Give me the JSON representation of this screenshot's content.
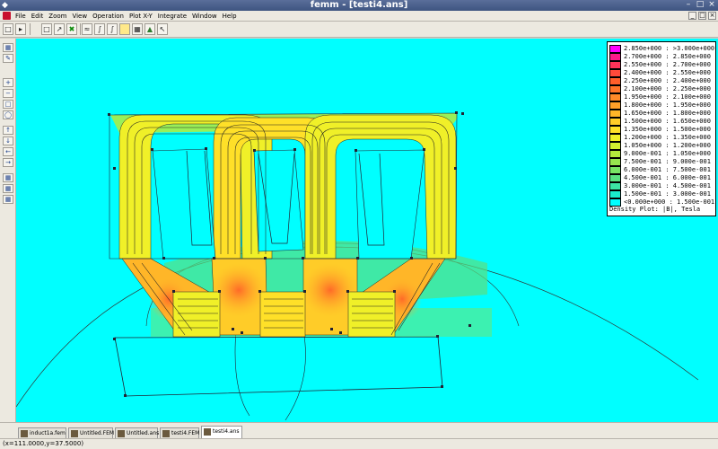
{
  "window": {
    "title": "femm - [testi4.ans]"
  },
  "menu": [
    "File",
    "Edit",
    "Zoom",
    "View",
    "Operation",
    "Plot X-Y",
    "Integrate",
    "Window",
    "Help"
  ],
  "legend": {
    "title": "Density Plot: |B|, Tesla",
    "rows": [
      {
        "label": "2.850e+000 : >3.000e+000",
        "color": "#ff00ff"
      },
      {
        "label": "2.700e+000 : 2.850e+000",
        "color": "#ff1a8c"
      },
      {
        "label": "2.550e+000 : 2.700e+000",
        "color": "#ff3358"
      },
      {
        "label": "2.400e+000 : 2.550e+000",
        "color": "#ff4a3a"
      },
      {
        "label": "2.250e+000 : 2.400e+000",
        "color": "#ff5e2a"
      },
      {
        "label": "2.100e+000 : 2.250e+000",
        "color": "#ff7428"
      },
      {
        "label": "1.950e+000 : 2.100e+000",
        "color": "#ff8a28"
      },
      {
        "label": "1.800e+000 : 1.950e+000",
        "color": "#ffa028"
      },
      {
        "label": "1.650e+000 : 1.800e+000",
        "color": "#ffb628"
      },
      {
        "label": "1.500e+000 : 1.650e+000",
        "color": "#ffcc28"
      },
      {
        "label": "1.350e+000 : 1.500e+000",
        "color": "#ffe028"
      },
      {
        "label": "1.200e+000 : 1.350e+000",
        "color": "#f0f028"
      },
      {
        "label": "1.050e+000 : 1.200e+000",
        "color": "#d2f030"
      },
      {
        "label": "9.000e-001 : 1.050e+000",
        "color": "#b4ec3c"
      },
      {
        "label": "7.500e-001 : 9.000e-001",
        "color": "#96e64e"
      },
      {
        "label": "6.000e-001 : 7.500e-001",
        "color": "#78e464"
      },
      {
        "label": "4.500e-001 : 6.000e-001",
        "color": "#5ae080"
      },
      {
        "label": "3.000e-001 : 4.500e-001",
        "color": "#3ce4a4"
      },
      {
        "label": "1.500e-001 : 3.000e-001",
        "color": "#1aeccc"
      },
      {
        "label": "<0.000e+000 : 1.500e-001",
        "color": "#00ffff"
      }
    ]
  },
  "tabs": [
    {
      "label": "induct1a.fem",
      "active": false
    },
    {
      "label": "Untitled.FEM",
      "active": false
    },
    {
      "label": "Untitled.ans",
      "active": false
    },
    {
      "label": "testi4.FEM",
      "active": false
    },
    {
      "label": "testi4.ans",
      "active": true
    }
  ],
  "status": "(x=111.0000,y=37.5000)",
  "icons": {
    "toolbar": [
      "new-file-icon",
      "open-file-icon",
      "select-point-icon",
      "select-segment-icon",
      "select-block-icon",
      "contour-icon",
      "line-integral-icon",
      "area-integral-icon",
      "density-plot-icon",
      "grid-icon",
      "vector-plot-icon",
      "mouse-pointer-icon"
    ],
    "sidebar": [
      "snap-grid-icon",
      "edit-icon",
      "zoom-in-icon",
      "zoom-out-icon",
      "zoom-window-icon",
      "zoom-natural-icon",
      "pan-up-icon",
      "pan-down-icon",
      "pan-left-icon",
      "pan-right-icon",
      "show-mesh-icon",
      "show-grid-icon",
      "set-grid-icon"
    ]
  }
}
